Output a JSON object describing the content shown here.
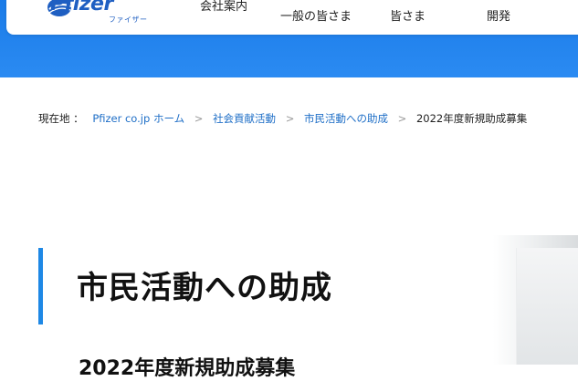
{
  "header": {
    "logo_text": "Pfizer",
    "logo_subtext": "ファイザー",
    "nav": [
      {
        "label": "会社案内"
      },
      {
        "label": "一般の皆さま"
      },
      {
        "label": "皆さま"
      },
      {
        "label": "開発"
      }
    ]
  },
  "breadcrumb": {
    "prefix": "現在地 ：",
    "items": [
      {
        "label": "Pfizer co.jp ホーム"
      },
      {
        "label": "社会貢献活動"
      },
      {
        "label": "市民活動への助成"
      }
    ],
    "current": "2022年度新規助成募集",
    "separator": ">"
  },
  "main": {
    "title": "市民活動への助成",
    "subtitle": "2022年度新規助成募集"
  },
  "colors": {
    "accent": "#1e88e5",
    "hero": "#2b8bf2",
    "link": "#1f6fc7",
    "brand": "#1f5fc2"
  }
}
